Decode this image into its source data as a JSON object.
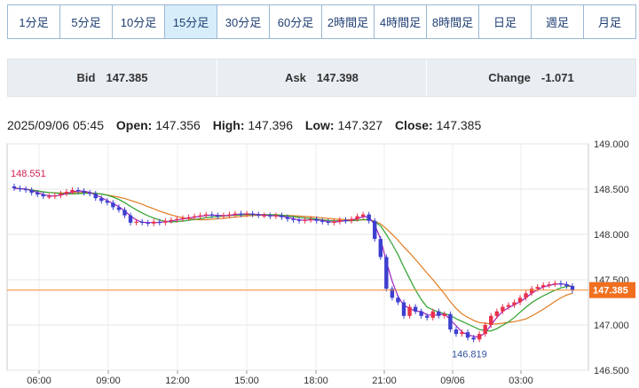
{
  "tabs": [
    {
      "label": "1分足"
    },
    {
      "label": "5分足"
    },
    {
      "label": "10分足"
    },
    {
      "label": "15分足"
    },
    {
      "label": "30分足"
    },
    {
      "label": "60分足"
    },
    {
      "label": "2時間足"
    },
    {
      "label": "4時間足"
    },
    {
      "label": "8時間足"
    },
    {
      "label": "日足"
    },
    {
      "label": "週足"
    },
    {
      "label": "月足"
    }
  ],
  "active_tab": "15分足",
  "quote": {
    "bid_label": "Bid",
    "bid_value": "147.385",
    "ask_label": "Ask",
    "ask_value": "147.398",
    "change_label": "Change",
    "change_value": "-1.071"
  },
  "ohlc": {
    "datetime": "2025/09/06 05:45",
    "open_label": "Open:",
    "open": "147.356",
    "high_label": "High:",
    "high": "147.396",
    "low_label": "Low:",
    "low": "147.327",
    "close_label": "Close:",
    "close": "147.385"
  },
  "colors": {
    "up": "#e8304a",
    "down": "#3d3fd0",
    "ma_short": "#a020c0",
    "ma_mid": "#2ca02c",
    "ma_long": "#e07b20",
    "current_line": "#f08a28",
    "price_tag": "#f07020",
    "tab_border": "#9bb7d2"
  },
  "chart_data": {
    "type": "candlestick",
    "y_range": [
      146.5,
      149.0
    ],
    "y_ticks": [
      "149.000",
      "148.500",
      "148.000",
      "147.500",
      "147.000",
      "146.500"
    ],
    "x_ticks": [
      "06:00",
      "09:00",
      "12:00",
      "15:00",
      "18:00",
      "21:00",
      "09/06",
      "03:00"
    ],
    "annotations": {
      "high_label": "148.551",
      "low_label": "146.819"
    },
    "current_price": "147.385",
    "close_series": [
      148.51,
      148.5,
      148.49,
      148.46,
      148.44,
      148.42,
      148.42,
      148.43,
      148.45,
      148.47,
      148.49,
      148.48,
      148.46,
      148.45,
      148.4,
      148.37,
      148.35,
      148.3,
      148.27,
      148.21,
      148.13,
      148.14,
      148.13,
      148.12,
      148.14,
      148.13,
      148.15,
      148.16,
      148.17,
      148.18,
      148.19,
      148.2,
      148.21,
      148.22,
      148.21,
      148.2,
      148.21,
      148.22,
      148.23,
      148.22,
      148.23,
      148.22,
      148.21,
      148.21,
      148.2,
      148.21,
      148.19,
      148.17,
      148.16,
      148.15,
      148.16,
      148.17,
      148.15,
      148.14,
      148.13,
      148.14,
      148.16,
      148.15,
      148.17,
      148.2,
      148.22,
      148.15,
      147.95,
      147.75,
      147.4,
      147.3,
      147.25,
      147.1,
      147.2,
      147.15,
      147.1,
      147.08,
      147.15,
      147.1,
      147.12,
      146.95,
      146.9,
      146.92,
      146.86,
      146.84,
      146.9,
      147.0,
      147.1,
      147.15,
      147.2,
      147.22,
      147.25,
      147.3,
      147.35,
      147.4,
      147.42,
      147.44,
      147.45,
      147.46,
      147.45,
      147.43,
      147.38
    ]
  }
}
